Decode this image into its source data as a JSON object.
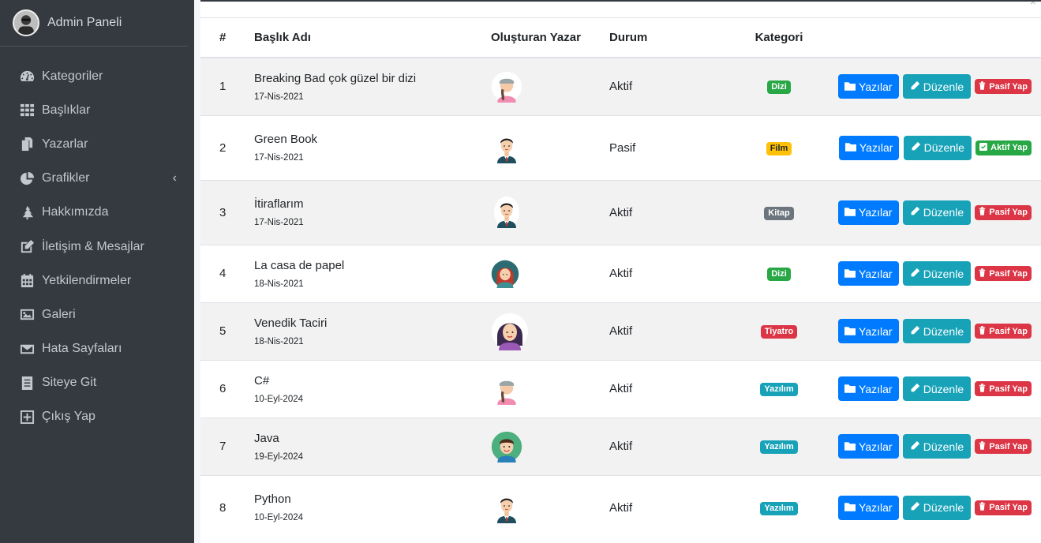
{
  "sidebar": {
    "brand": "Admin Paneli",
    "items": [
      {
        "label": "Kategoriler",
        "icon": "tachometer-icon"
      },
      {
        "label": "Başlıklar",
        "icon": "grid-icon"
      },
      {
        "label": "Yazarlar",
        "icon": "copy-icon"
      },
      {
        "label": "Grafikler",
        "icon": "pie-chart-icon"
      },
      {
        "label": "Hakkımızda",
        "icon": "tree-icon"
      },
      {
        "label": "İletişim & Mesajlar",
        "icon": "edit-icon"
      },
      {
        "label": "Yetkilendirmeler",
        "icon": "calendar-icon"
      },
      {
        "label": "Galeri",
        "icon": "image-icon"
      },
      {
        "label": "Hata Sayfaları",
        "icon": "envelope-icon"
      },
      {
        "label": "Siteye Git",
        "icon": "list-icon"
      },
      {
        "label": "Çıkış Yap",
        "icon": "plus-square-icon"
      }
    ],
    "grafikler_arrow": "‹"
  },
  "table": {
    "headers": {
      "num": "#",
      "title": "Başlık Adı",
      "author": "Oluşturan Yazar",
      "status": "Durum",
      "category": "Kategori"
    },
    "rows": [
      {
        "num": "1",
        "title": "Breaking Bad çok güzel bir dizi",
        "date": "17-Nis-2021",
        "author_avatar": "woman-grey-hat",
        "status": "Aktif",
        "category": "Dizi",
        "category_color": "#28a745",
        "toggle": "Pasif Yap"
      },
      {
        "num": "2",
        "title": "Green Book",
        "date": "17-Nis-2021",
        "author_avatar": "man-suit",
        "status": "Pasif",
        "category": "Film",
        "category_color": "#ffc107",
        "toggle": "Aktif Yap"
      },
      {
        "num": "3",
        "title": "İtiraflarım",
        "date": "17-Nis-2021",
        "author_avatar": "man-suit",
        "status": "Aktif",
        "category": "Kitap",
        "category_color": "#6c757d",
        "toggle": "Pasif Yap"
      },
      {
        "num": "4",
        "title": "La casa de papel",
        "date": "18-Nis-2021",
        "author_avatar": "woman-red-hair",
        "status": "Aktif",
        "category": "Dizi",
        "category_color": "#28a745",
        "toggle": "Pasif Yap"
      },
      {
        "num": "5",
        "title": "Venedik Taciri",
        "date": "18-Nis-2021",
        "author_avatar": "woman-purple",
        "status": "Aktif",
        "category": "Tiyatro",
        "category_color": "#dc3545",
        "toggle": "Pasif Yap"
      },
      {
        "num": "6",
        "title": "C#",
        "date": "10-Eyl-2024",
        "author_avatar": "woman-grey-hat",
        "status": "Aktif",
        "category": "Yazılım",
        "category_color": "#17a2b8",
        "toggle": "Pasif Yap"
      },
      {
        "num": "7",
        "title": "Java",
        "date": "19-Eyl-2024",
        "author_avatar": "boy-green-circle",
        "status": "Aktif",
        "category": "Yazılım",
        "category_color": "#17a2b8",
        "toggle": "Pasif Yap"
      },
      {
        "num": "8",
        "title": "Python",
        "date": "10-Eyl-2024",
        "author_avatar": "man-suit",
        "status": "Aktif",
        "category": "Yazılım",
        "category_color": "#17a2b8",
        "toggle": "Pasif Yap"
      }
    ],
    "buttons": {
      "posts": "Yazılar",
      "edit": "Düzenle"
    }
  },
  "colors": {
    "sidebar_bg": "#343a40",
    "primary": "#007bff",
    "info": "#17a2b8",
    "danger": "#dc3545",
    "success": "#28a745"
  }
}
